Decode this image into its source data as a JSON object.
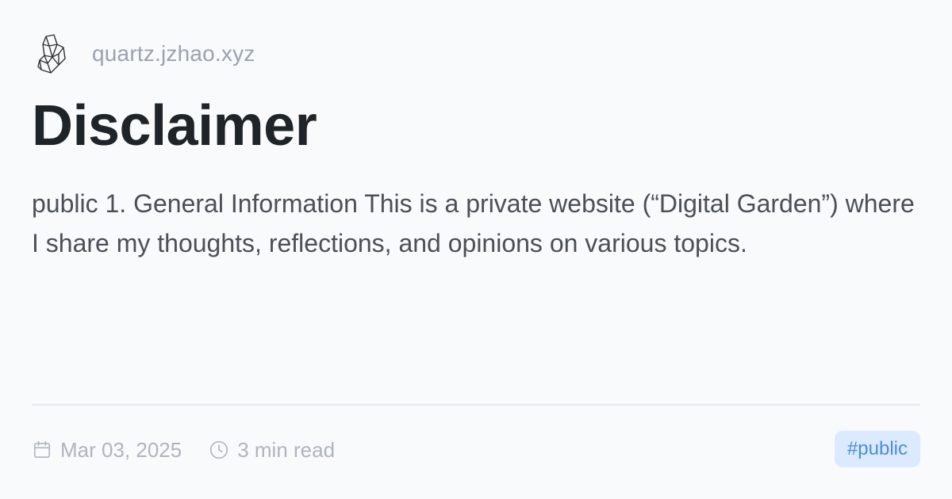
{
  "header": {
    "logo_icon": "crystal-logo-icon",
    "site_url": "quartz.jzhao.xyz"
  },
  "page": {
    "title": "Disclaimer",
    "description": "public 1. General Information This is a private website (“Digital Garden”) where I share my thoughts, reflections, and opinions on various topics."
  },
  "meta": {
    "date_icon": "calendar-icon",
    "date": "Mar 03, 2025",
    "reading_time_icon": "clock-icon",
    "reading_time": "3 min read"
  },
  "tag": {
    "label": "#public"
  },
  "colors": {
    "background": "#f8fafc",
    "title": "#1f2428",
    "text": "#4b5057",
    "muted": "#9ca3af",
    "tag_bg": "#dbeafe",
    "tag_text": "#4a8de0"
  }
}
